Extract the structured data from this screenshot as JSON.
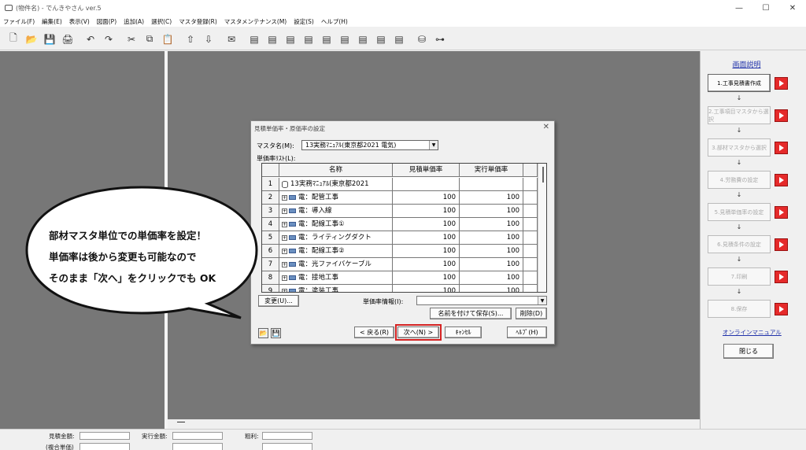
{
  "window": {
    "title": "(物件名) - でんきやさん ver.5",
    "controls": [
      "—",
      "☐",
      "✕"
    ]
  },
  "menu": [
    "ファイル(F)",
    "編集(E)",
    "表示(V)",
    "図面(P)",
    "追加(A)",
    "選択(C)",
    "マスタ登録(R)",
    "マスタメンテナンス(M)",
    "設定(S)",
    "ヘルプ(H)"
  ],
  "toolbar": {
    "icons": [
      "new-file-icon",
      "open-folder-icon",
      "save-icon",
      "print-icon",
      "undo-icon",
      "redo-icon",
      "cut-icon",
      "copy-icon",
      "paste-icon",
      "move-up-icon",
      "move-down-icon",
      "report-icon",
      "doc1-icon",
      "doc2-icon",
      "doc3-icon",
      "doc4-icon",
      "doc5-icon",
      "doc6-icon",
      "doc7-icon",
      "doc8-icon",
      "doc9-icon",
      "database-icon",
      "connect-icon"
    ],
    "glyphs": [
      "🗋",
      "📂",
      "💾",
      "🖨",
      "↶",
      "↷",
      "✂",
      "⧉",
      "📋",
      "⇧",
      "⇩",
      "✉",
      "▤",
      "▤",
      "▤",
      "▤",
      "▤",
      "▤",
      "▤",
      "▤",
      "▤",
      "⛁",
      "⊶"
    ]
  },
  "right_panel": {
    "title": "画面説明",
    "steps": [
      {
        "label": "1.工事見積書作成",
        "active": true
      },
      {
        "label": "2.工事項目マスタから選択",
        "active": false
      },
      {
        "label": "3.部材マスタから選択",
        "active": false
      },
      {
        "label": "4.労務費の設定",
        "active": false
      },
      {
        "label": "5.見積単価率の設定",
        "active": false
      },
      {
        "label": "6.見積条件の設定",
        "active": false
      },
      {
        "label": "7.印刷",
        "active": false
      },
      {
        "label": "8.保存",
        "active": false
      }
    ],
    "arrow": "↓",
    "manual_link": "オンラインマニュアル",
    "close_button": "閉じる"
  },
  "statusbar": {
    "estimate_amount": "見積金額:",
    "execution_amount": "実行金額:",
    "gross_profit": "粗利:",
    "composite_unit": "(複合単価)"
  },
  "dialog": {
    "title": "見積単価率・原価率の設定",
    "close": "✕",
    "master_label": "マスタ名(M):",
    "master_value": "13実務ﾏﾆｭｱﾙ(東京都2021 電気)",
    "list_label": "単価率ﾘｽﾄ(L):",
    "columns": [
      "名称",
      "見積単価率",
      "実行単価率"
    ],
    "rows": [
      {
        "no": "1",
        "name": "13実務ﾏﾆｭｱﾙ(東京都2021",
        "est": "",
        "exe": "",
        "root": true
      },
      {
        "no": "2",
        "name": "電：配管工事",
        "est": "100",
        "exe": "100"
      },
      {
        "no": "3",
        "name": "電：導入線",
        "est": "100",
        "exe": "100"
      },
      {
        "no": "4",
        "name": "電：配線工事①",
        "est": "100",
        "exe": "100"
      },
      {
        "no": "5",
        "name": "電：ライティングダクト",
        "est": "100",
        "exe": "100"
      },
      {
        "no": "6",
        "name": "電：配線工事②",
        "est": "100",
        "exe": "100"
      },
      {
        "no": "7",
        "name": "電：光ファイバケーブル",
        "est": "100",
        "exe": "100"
      },
      {
        "no": "8",
        "name": "電：接地工事",
        "est": "100",
        "exe": "100"
      },
      {
        "no": "9",
        "name": "電：塗装工事",
        "est": "100",
        "exe": "100"
      }
    ],
    "change_button": "変更(U)...",
    "info_label": "単価率情報(I):",
    "save_as_button": "名前を付けて保存(S)...",
    "delete_button": "削除(D)",
    "back_button": "< 戻る(R)",
    "next_button": "次へ(N) >",
    "cancel_button": "ｷｬﾝｾﾙ",
    "help_button": "ﾍﾙﾌﾟ(H)"
  },
  "callout": {
    "lines": [
      "部材マスタ単位での単価率を設定！",
      "単価率は後から変更も可能なので",
      "そのまま「次へ」をクリックでも OK"
    ]
  }
}
